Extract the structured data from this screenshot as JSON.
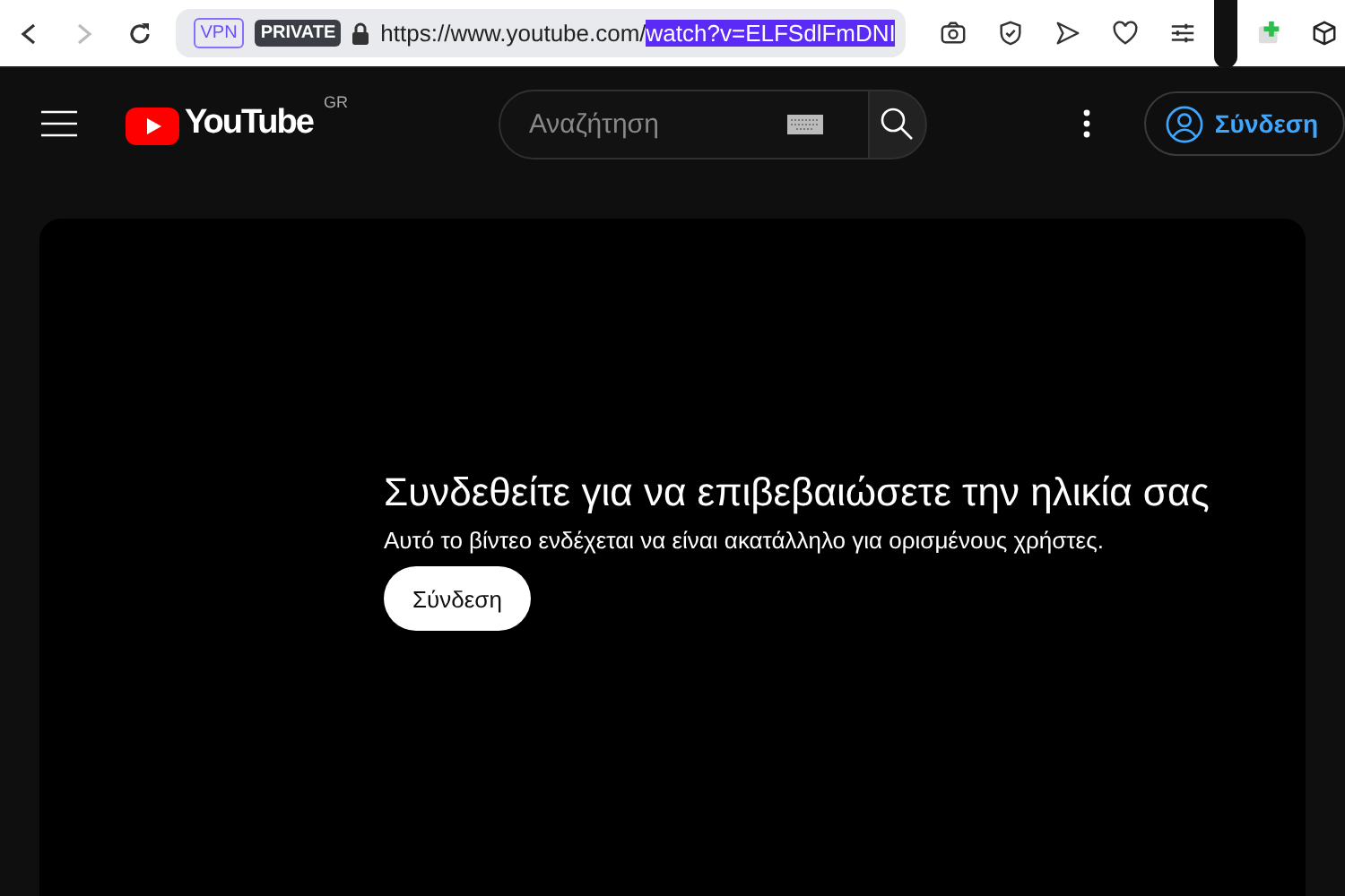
{
  "browser": {
    "nav": [
      {
        "kind": "back",
        "disabled": false
      },
      {
        "kind": "forward",
        "disabled": true
      },
      {
        "kind": "reload",
        "disabled": false
      }
    ],
    "badges": [
      {
        "kind": "vpn",
        "label": "VPN"
      },
      {
        "kind": "private",
        "label": "PRIVATE"
      }
    ],
    "url_parts": [
      {
        "text": "https://www.youtube.com/",
        "selected": false
      },
      {
        "text": "watch?v=ELFSdlFmDNI",
        "selected": true
      }
    ],
    "tools": [
      {
        "kind": "camera"
      },
      {
        "kind": "shield"
      },
      {
        "kind": "send"
      },
      {
        "kind": "heart"
      },
      {
        "kind": "sliders"
      }
    ],
    "extensions": [
      {
        "kind": "puzzle"
      },
      {
        "kind": "cube"
      }
    ]
  },
  "header": {
    "logo": "YouTube",
    "country": "GR",
    "search": {
      "placeholder": "Αναζήτηση"
    },
    "sign_in": "Σύνδεση"
  },
  "player": {
    "title": "Συνδεθείτε για να επιβεβαιώσετε την ηλικία σας",
    "message": "Αυτό το βίντεο ενδέχεται να είναι ακατάλληλο για ορισμένους χρήστες.",
    "button": "Σύνδεση"
  }
}
